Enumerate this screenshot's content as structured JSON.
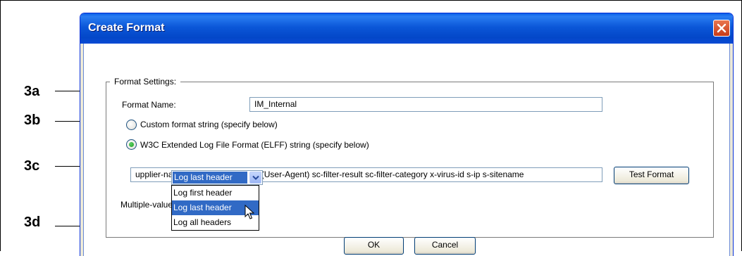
{
  "callouts": [
    "3a",
    "3b",
    "3c",
    "3d"
  ],
  "dialog": {
    "title": "Create Format"
  },
  "format_settings": {
    "legend": "Format Settings:",
    "format_name_label": "Format Name:",
    "format_name_value": "IM_Internal",
    "radio_custom_label": "Custom format string (specify below)",
    "radio_custom_checked": false,
    "radio_elff_label": "W3C Extended Log File Format (ELFF) string (specify below)",
    "radio_elff_checked": true,
    "format_string_value": "upplier-name rs(Content-Type) cs(User-Agent) sc-filter-result sc-filter-category x-virus-id s-ip s-sitename",
    "test_format_button": "Test Format",
    "header_policy_label": "Multiple-valued header policy:",
    "header_policy_selected": "Log last header",
    "header_policy_options": [
      "Log first header",
      "Log last header",
      "Log all headers"
    ],
    "highlighted_option": "Log last header"
  },
  "buttons": {
    "ok": "OK",
    "cancel": "Cancel"
  },
  "colors": {
    "title_bar": "#0a5fe8",
    "selection": "#316ac5",
    "radio_dot": "#21a121",
    "close_button": "#c93b17"
  }
}
